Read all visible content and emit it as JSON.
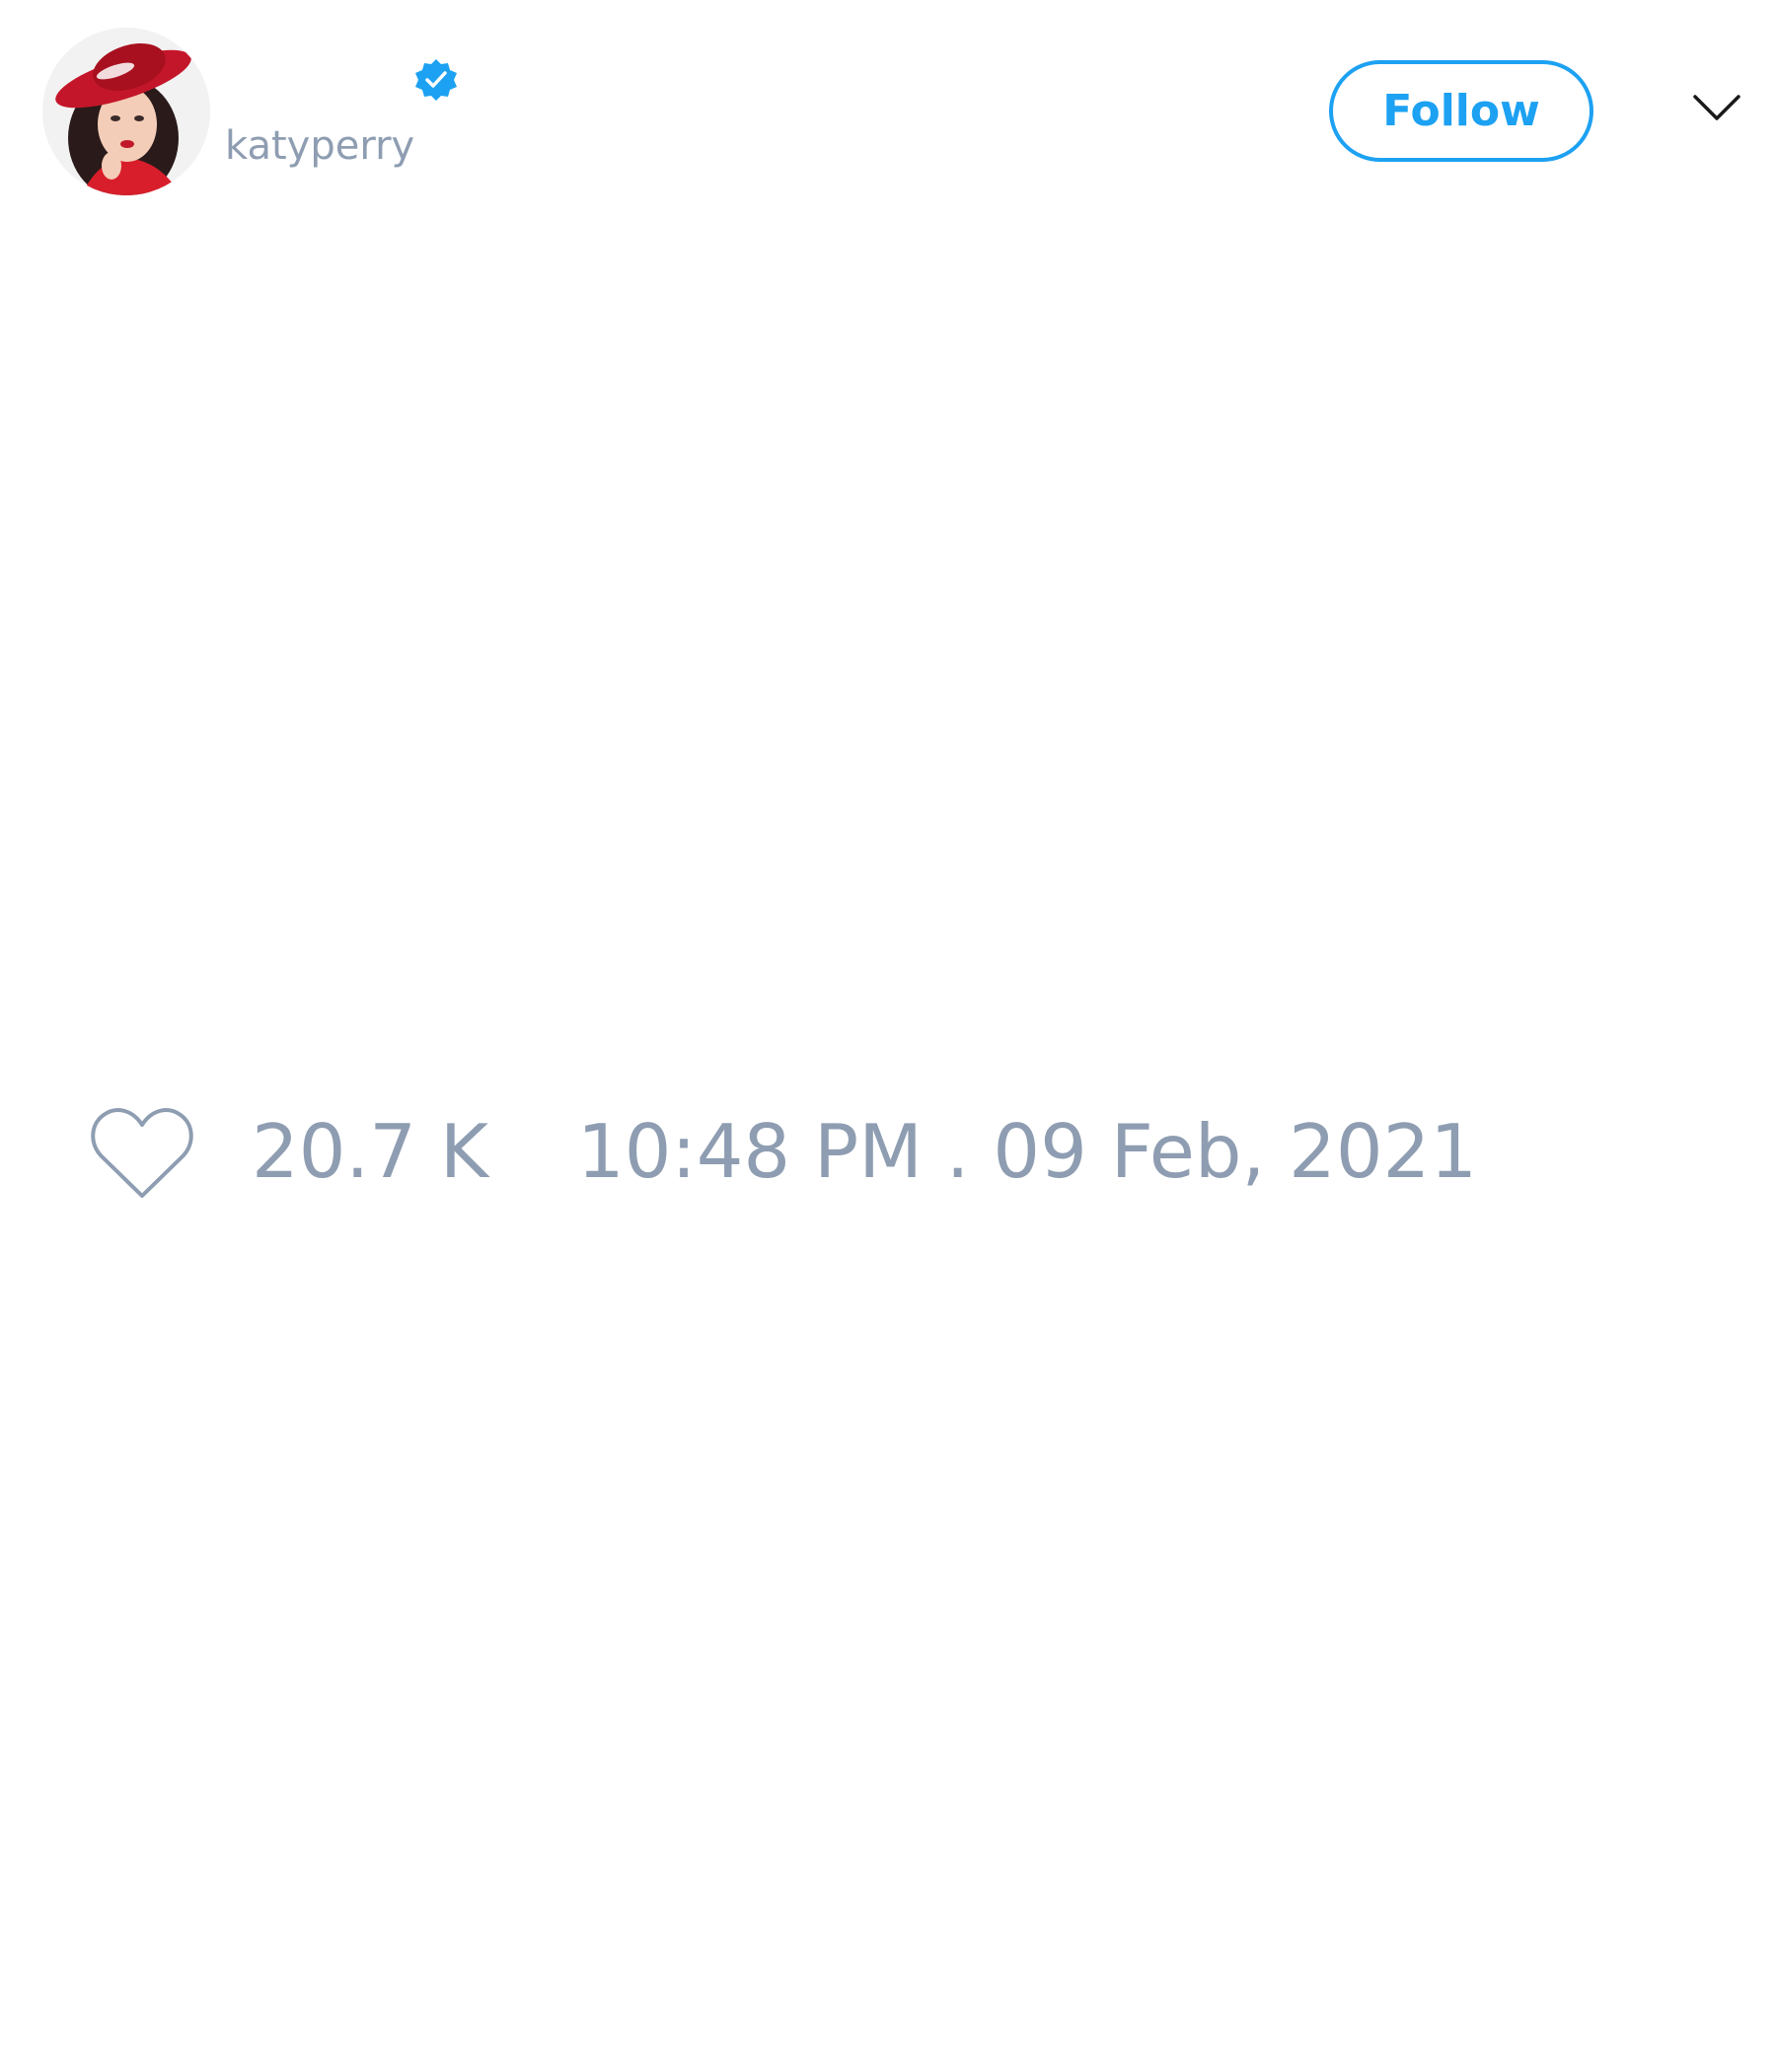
{
  "tweet": {
    "author": {
      "display_name": "",
      "handle": "katyperry",
      "verified_icon": "verified-badge-icon",
      "avatar_icon": "profile-photo"
    },
    "follow_label": "Follow",
    "menu_icon": "chevron-down-icon",
    "like_icon": "heart-outline-icon",
    "like_count": "20.7 K",
    "timestamp": "10:48 PM . 09 Feb, 2021"
  },
  "colors": {
    "accent": "#1da1f2",
    "muted_text": "#8e9db1",
    "background": "#ffffff"
  }
}
